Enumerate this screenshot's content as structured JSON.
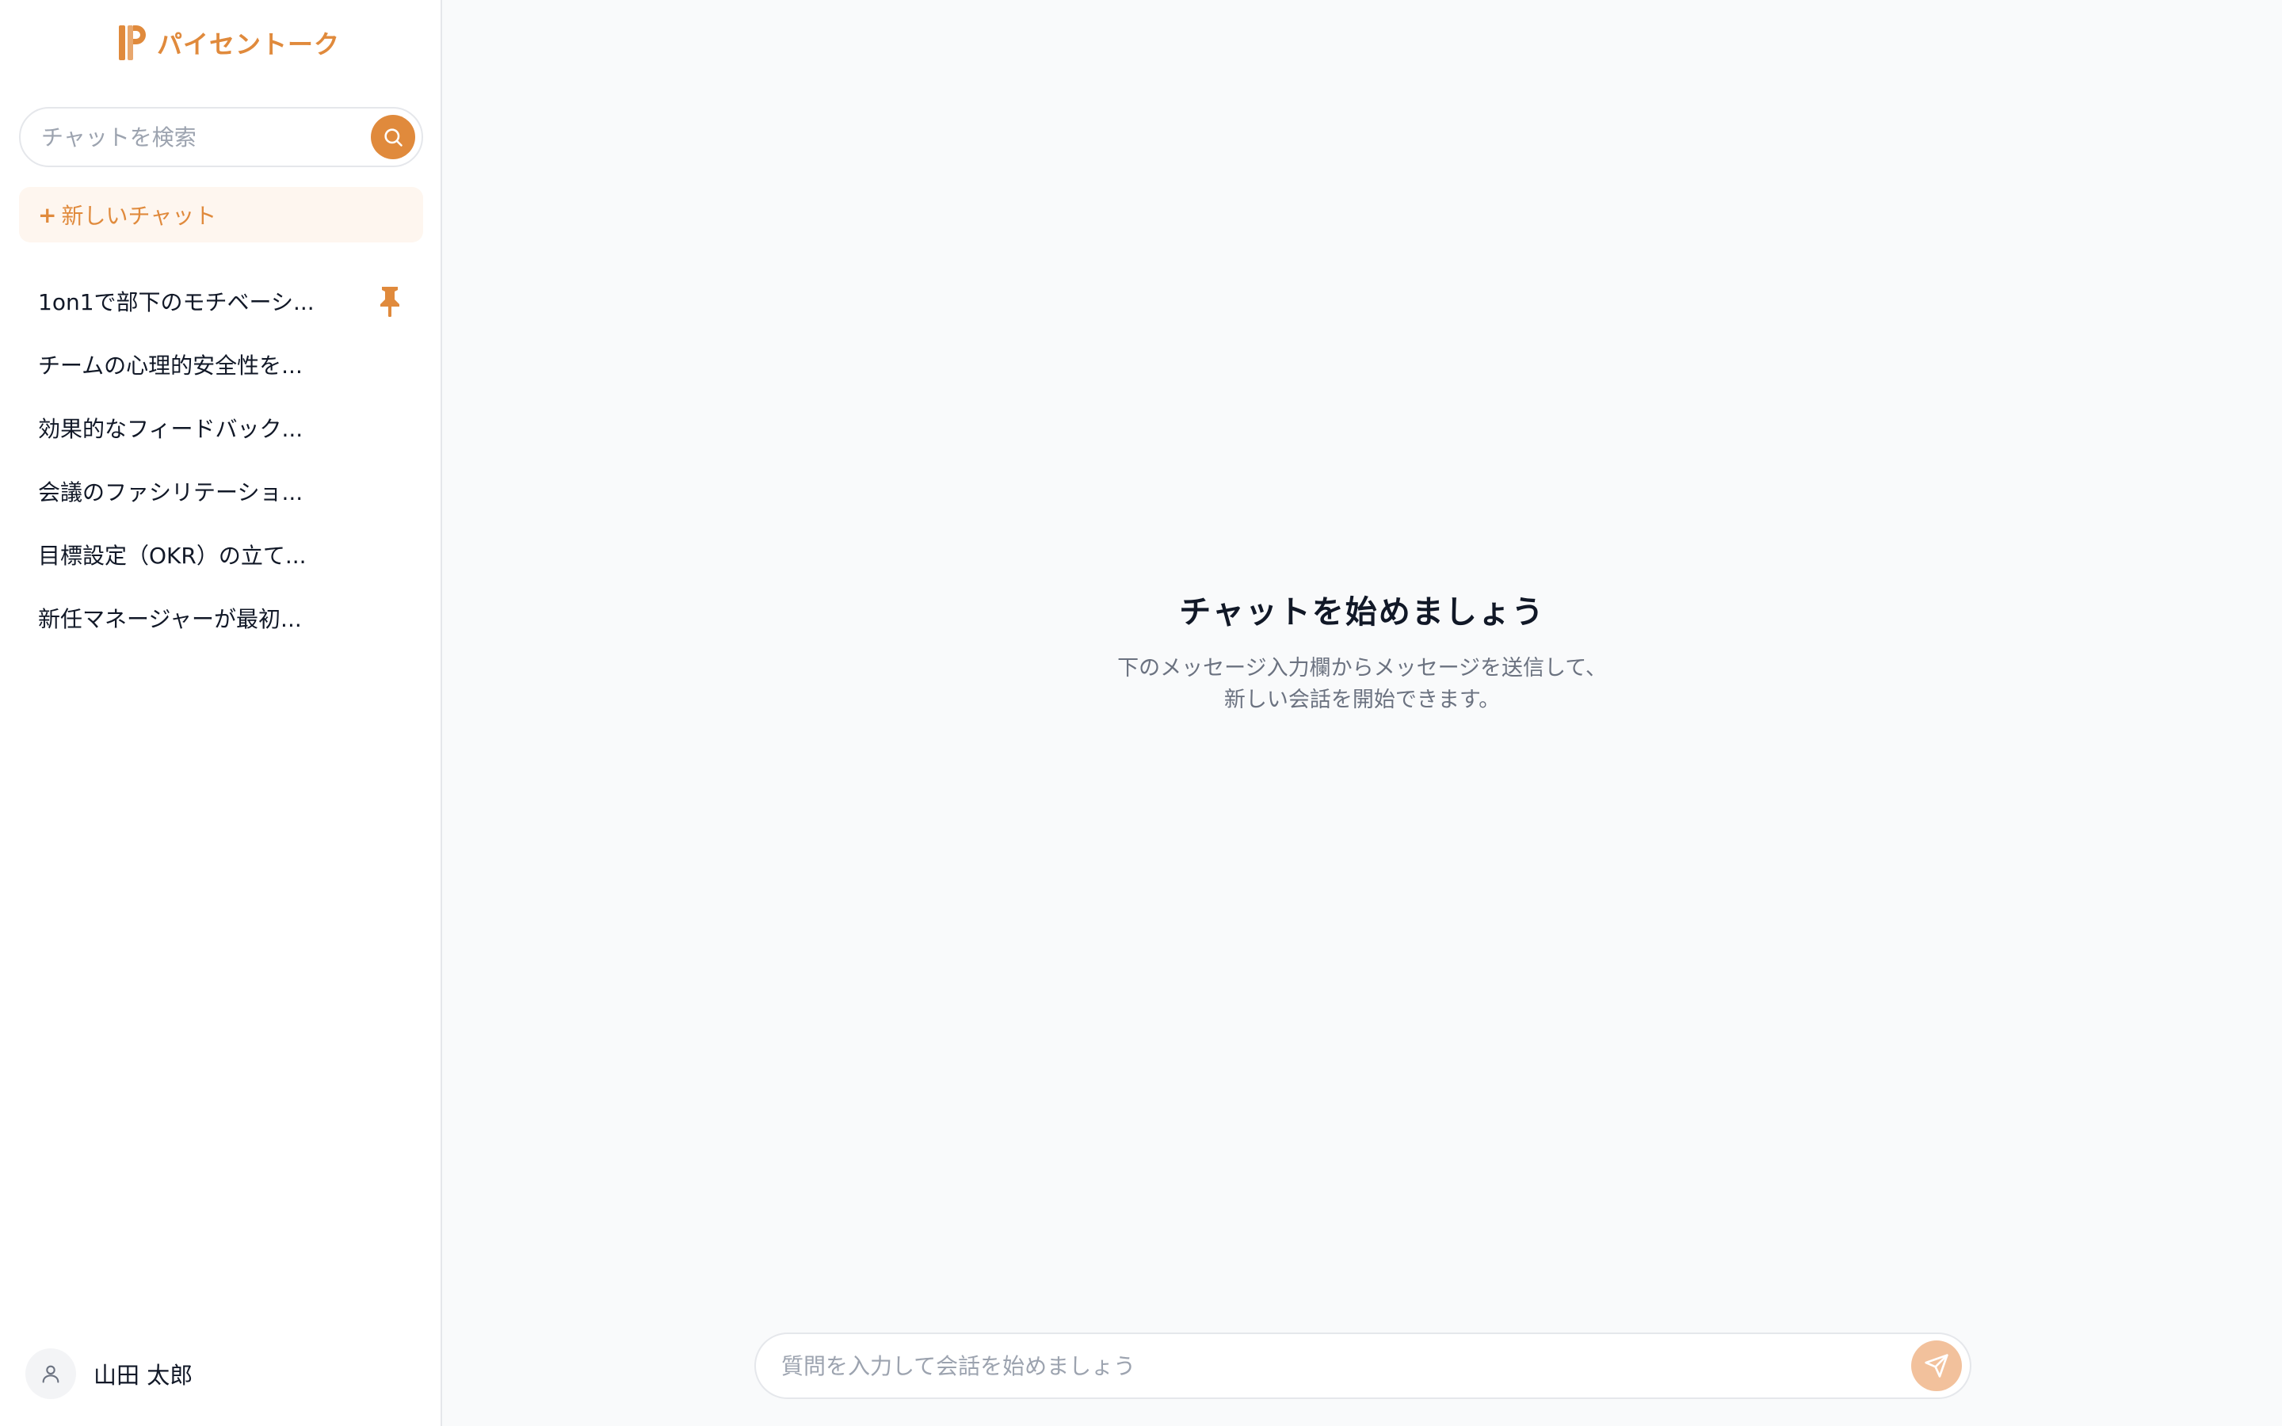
{
  "brand": {
    "name": "パイセントーク",
    "accent_color": "#e08a3c",
    "logo_icon": "p-logo-icon"
  },
  "sidebar": {
    "search": {
      "placeholder": "チャットを検索",
      "value": "",
      "icon": "search-icon"
    },
    "new_chat": {
      "plus": "+",
      "label": "新しいチャット"
    },
    "chats": [
      {
        "label": "1on1で部下のモチベーシ...",
        "pinned": true
      },
      {
        "label": "チームの心理的安全性を...",
        "pinned": false
      },
      {
        "label": "効果的なフィードバック...",
        "pinned": false
      },
      {
        "label": "会議のファシリテーショ...",
        "pinned": false
      },
      {
        "label": "目標設定（OKR）の立て...",
        "pinned": false
      },
      {
        "label": "新任マネージャーが最初...",
        "pinned": false
      }
    ],
    "user": {
      "name": "山田 太郎",
      "icon": "user-icon"
    }
  },
  "main": {
    "empty_title": "チャットを始めましょう",
    "empty_desc_line1": "下のメッセージ入力欄からメッセージを送信して、",
    "empty_desc_line2": "新しい会話を開始できます。",
    "composer": {
      "placeholder": "質問を入力して会話を始めましょう",
      "value": "",
      "send_icon": "send-icon"
    }
  }
}
